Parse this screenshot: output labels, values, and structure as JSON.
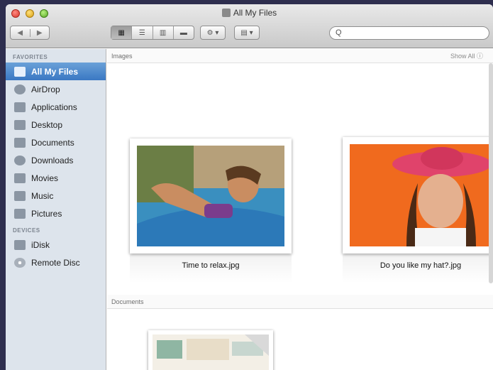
{
  "window": {
    "title": "All My Files"
  },
  "toolbar": {
    "back": "◀",
    "forward": "▶",
    "views": [
      "▦",
      "☰",
      "▥",
      "▬"
    ],
    "action": "⚙ ▾",
    "arrange": "▤ ▾",
    "search_placeholder": "Q"
  },
  "sidebar": {
    "favorites_header": "FAVORITES",
    "favorites": [
      {
        "label": "All My Files",
        "icon": "all-files-icon"
      },
      {
        "label": "AirDrop",
        "icon": "airdrop-icon"
      },
      {
        "label": "Applications",
        "icon": "applications-icon"
      },
      {
        "label": "Desktop",
        "icon": "desktop-icon"
      },
      {
        "label": "Documents",
        "icon": "documents-icon"
      },
      {
        "label": "Downloads",
        "icon": "downloads-icon"
      },
      {
        "label": "Movies",
        "icon": "movies-icon"
      },
      {
        "label": "Music",
        "icon": "music-icon"
      },
      {
        "label": "Pictures",
        "icon": "pictures-icon"
      }
    ],
    "devices_header": "DEVICES",
    "devices": [
      {
        "label": "iDisk",
        "icon": "idisk-icon"
      },
      {
        "label": "Remote Disc",
        "icon": "remote-disc-icon"
      }
    ]
  },
  "content": {
    "images_header": "Images",
    "show_all": "Show All ⓘ",
    "images": [
      {
        "filename": "Time to relax.jpg"
      },
      {
        "filename": "Do you like my hat?.jpg"
      }
    ],
    "documents_header": "Documents"
  }
}
